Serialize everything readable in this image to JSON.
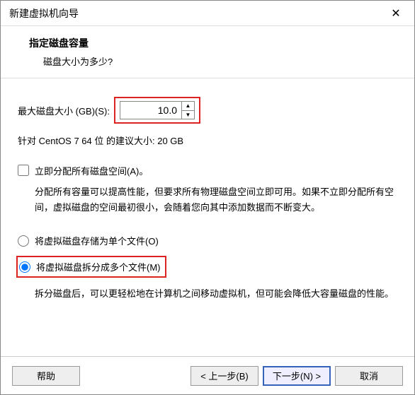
{
  "window": {
    "title": "新建虚拟机向导",
    "close_glyph": "✕"
  },
  "header": {
    "title": "指定磁盘容量",
    "subtitle": "磁盘大小为多少?"
  },
  "disk": {
    "label": "最大磁盘大小 (GB)(S):",
    "value": "10.0",
    "recommend": "针对 CentOS 7 64 位 的建议大小: 20 GB"
  },
  "allocate": {
    "checkbox_label": "立即分配所有磁盘空间(A)。",
    "checked": false,
    "desc": "分配所有容量可以提高性能，但要求所有物理磁盘空间立即可用。如果不立即分配所有空间，虚拟磁盘的空间最初很小，会随着您向其中添加数据而不断变大。"
  },
  "storage": {
    "option_single": "将虚拟磁盘存储为单个文件(O)",
    "option_split": "将虚拟磁盘拆分成多个文件(M)",
    "selected": "split",
    "split_desc": "拆分磁盘后，可以更轻松地在计算机之间移动虚拟机，但可能会降低大容量磁盘的性能。"
  },
  "footer": {
    "help": "帮助",
    "back": "< 上一步(B)",
    "next": "下一步(N) >",
    "cancel": "取消"
  },
  "spin": {
    "up": "▲",
    "down": "▼"
  }
}
